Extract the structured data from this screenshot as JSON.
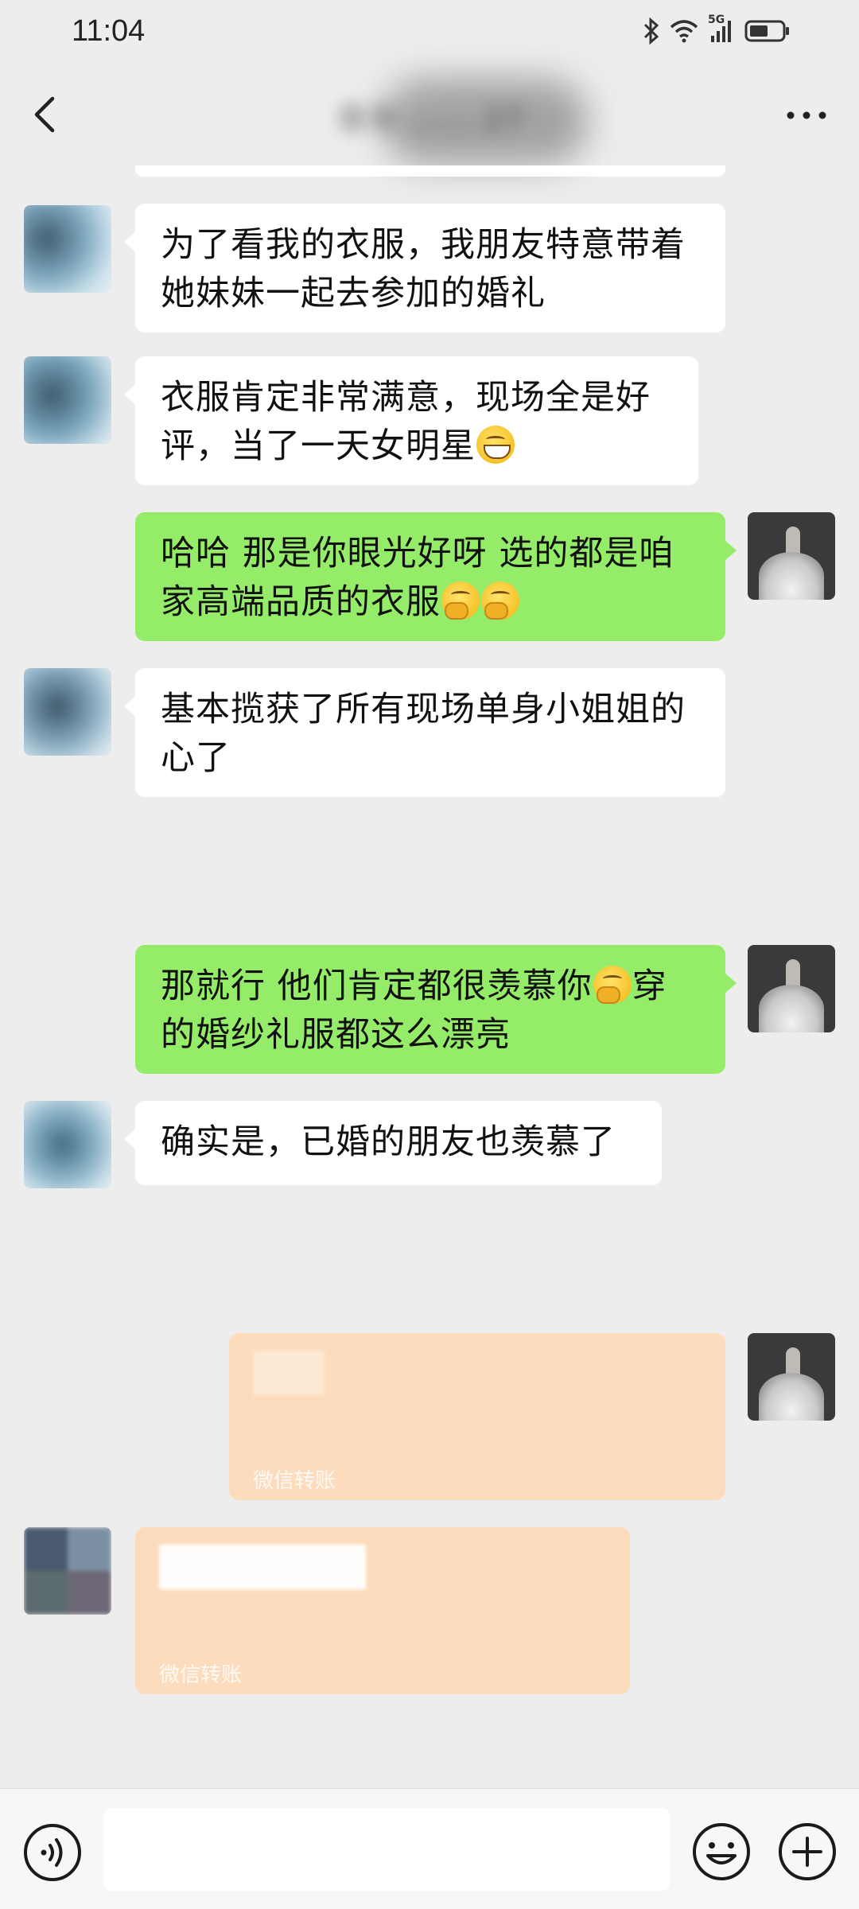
{
  "status_bar": {
    "time": "11:04",
    "network_label": "5G",
    "icons": [
      "bluetooth-icon",
      "wifi-icon",
      "signal-icon",
      "battery-icon"
    ]
  },
  "nav": {
    "title": "青年 …… 27",
    "back_icon": "chevron-left-icon",
    "more_icon": "more-dots-icon"
  },
  "messages": [
    {
      "side": "in",
      "text": "为了看我的衣服，我朋友特意带着她妹妹一起去参加的婚礼"
    },
    {
      "side": "in",
      "text": "衣服肯定非常满意，现场全是好评，当了一天女明星",
      "emoji": [
        "grin"
      ]
    },
    {
      "side": "out",
      "text": "哈哈 那是你眼光好呀 选的都是咱家高端品质的衣服",
      "emoji": [
        "thinking",
        "thinking"
      ]
    },
    {
      "side": "in",
      "text": "基本揽获了所有现场单身小姐姐的心了"
    },
    {
      "side": "out",
      "text_before": "那就行 他们肯定都很羡慕你",
      "text_after": "穿的婚纱礼服都这么漂亮",
      "emoji": [
        "thinking"
      ]
    },
    {
      "side": "in",
      "text": "确实是，已婚的朋友也羡慕了"
    },
    {
      "side": "out",
      "type": "transfer",
      "label": "微信转账"
    },
    {
      "side": "in",
      "type": "transfer",
      "label": "微信转账"
    }
  ],
  "input_bar": {
    "voice_icon": "voice-icon",
    "emoji_icon": "emoji-icon",
    "plus_icon": "plus-icon",
    "input_value": ""
  },
  "colors": {
    "background": "#ededed",
    "incoming_bubble": "#ffffff",
    "outgoing_bubble": "#95ec69",
    "transfer_bubble": "#fcdcbc"
  }
}
